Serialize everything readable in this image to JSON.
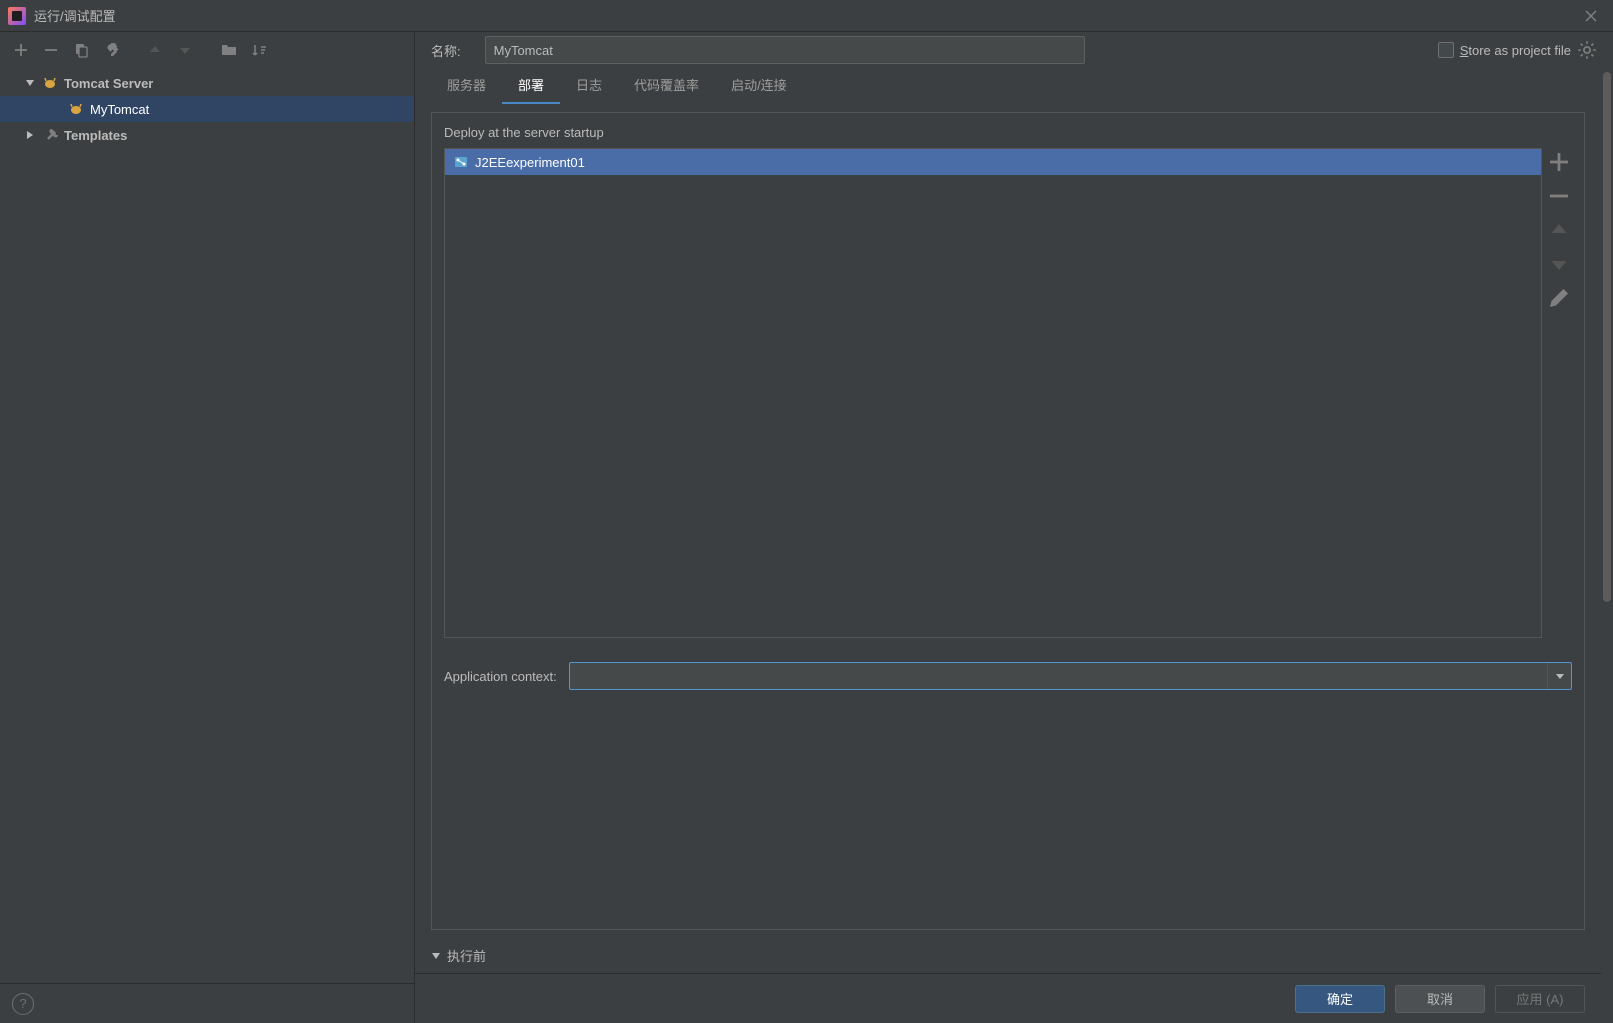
{
  "window": {
    "title": "运行/调试配置"
  },
  "header": {
    "name_label": "名称:",
    "name_value": "MyTomcat",
    "store_label_prefix": "S",
    "store_label_rest": "tore as project file"
  },
  "tree": {
    "tomcat_server": "Tomcat Server",
    "mytomcat": "MyTomcat",
    "templates": "Templates"
  },
  "tabs": {
    "server": "服务器",
    "deployment": "部署",
    "logs": "日志",
    "coverage": "代码覆盖率",
    "startup": "启动/连接"
  },
  "deploy": {
    "section_label": "Deploy at the server startup",
    "items": [
      "J2EEexperiment01"
    ]
  },
  "app_context": {
    "label": "Application context:",
    "value": ""
  },
  "before_launch": {
    "label": "执行前"
  },
  "buttons": {
    "ok": "确定",
    "cancel": "取消",
    "apply": "应用 (A)"
  }
}
